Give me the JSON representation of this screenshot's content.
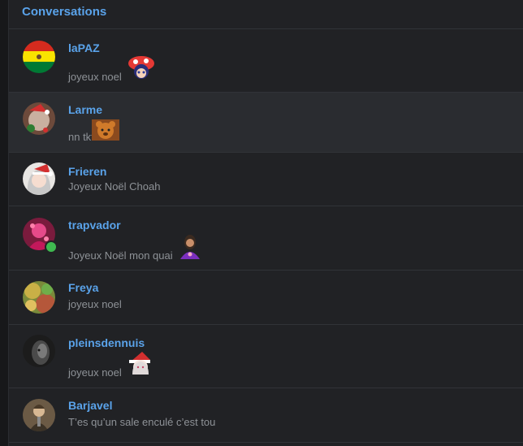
{
  "header": {
    "title": "Conversations"
  },
  "conversations": [
    {
      "name": "laPAZ",
      "message": "joyeux noel",
      "avatar": "bolivia-flag",
      "emoji": "mushroom-hat-sticker"
    },
    {
      "name": "Larme",
      "message": "nn tkt",
      "avatar": "festive-pet",
      "emoji": "bear-sticker"
    },
    {
      "name": "Frieren",
      "message": "Joyeux Noël Choah",
      "avatar": "anime-girl-santa-hat"
    },
    {
      "name": "trapvador",
      "message": "Joyeux Noël mon quai",
      "avatar": "pink-figure",
      "emoji": "woman-sticker",
      "online": true
    },
    {
      "name": "Freya",
      "message": "joyeux noel",
      "avatar": "colorful-blur"
    },
    {
      "name": "pleinsdennuis",
      "message": "joyeux noel",
      "avatar": "dark-face",
      "emoji": "santa-girl-sticker"
    },
    {
      "name": "Barjavel",
      "message": "T’es qu’un sale enculé c’est tou",
      "avatar": "warrior-portrait"
    }
  ],
  "colors": {
    "accent": "#5aa3ea",
    "online": "#3fb950",
    "active_row": "#2a2c30"
  }
}
